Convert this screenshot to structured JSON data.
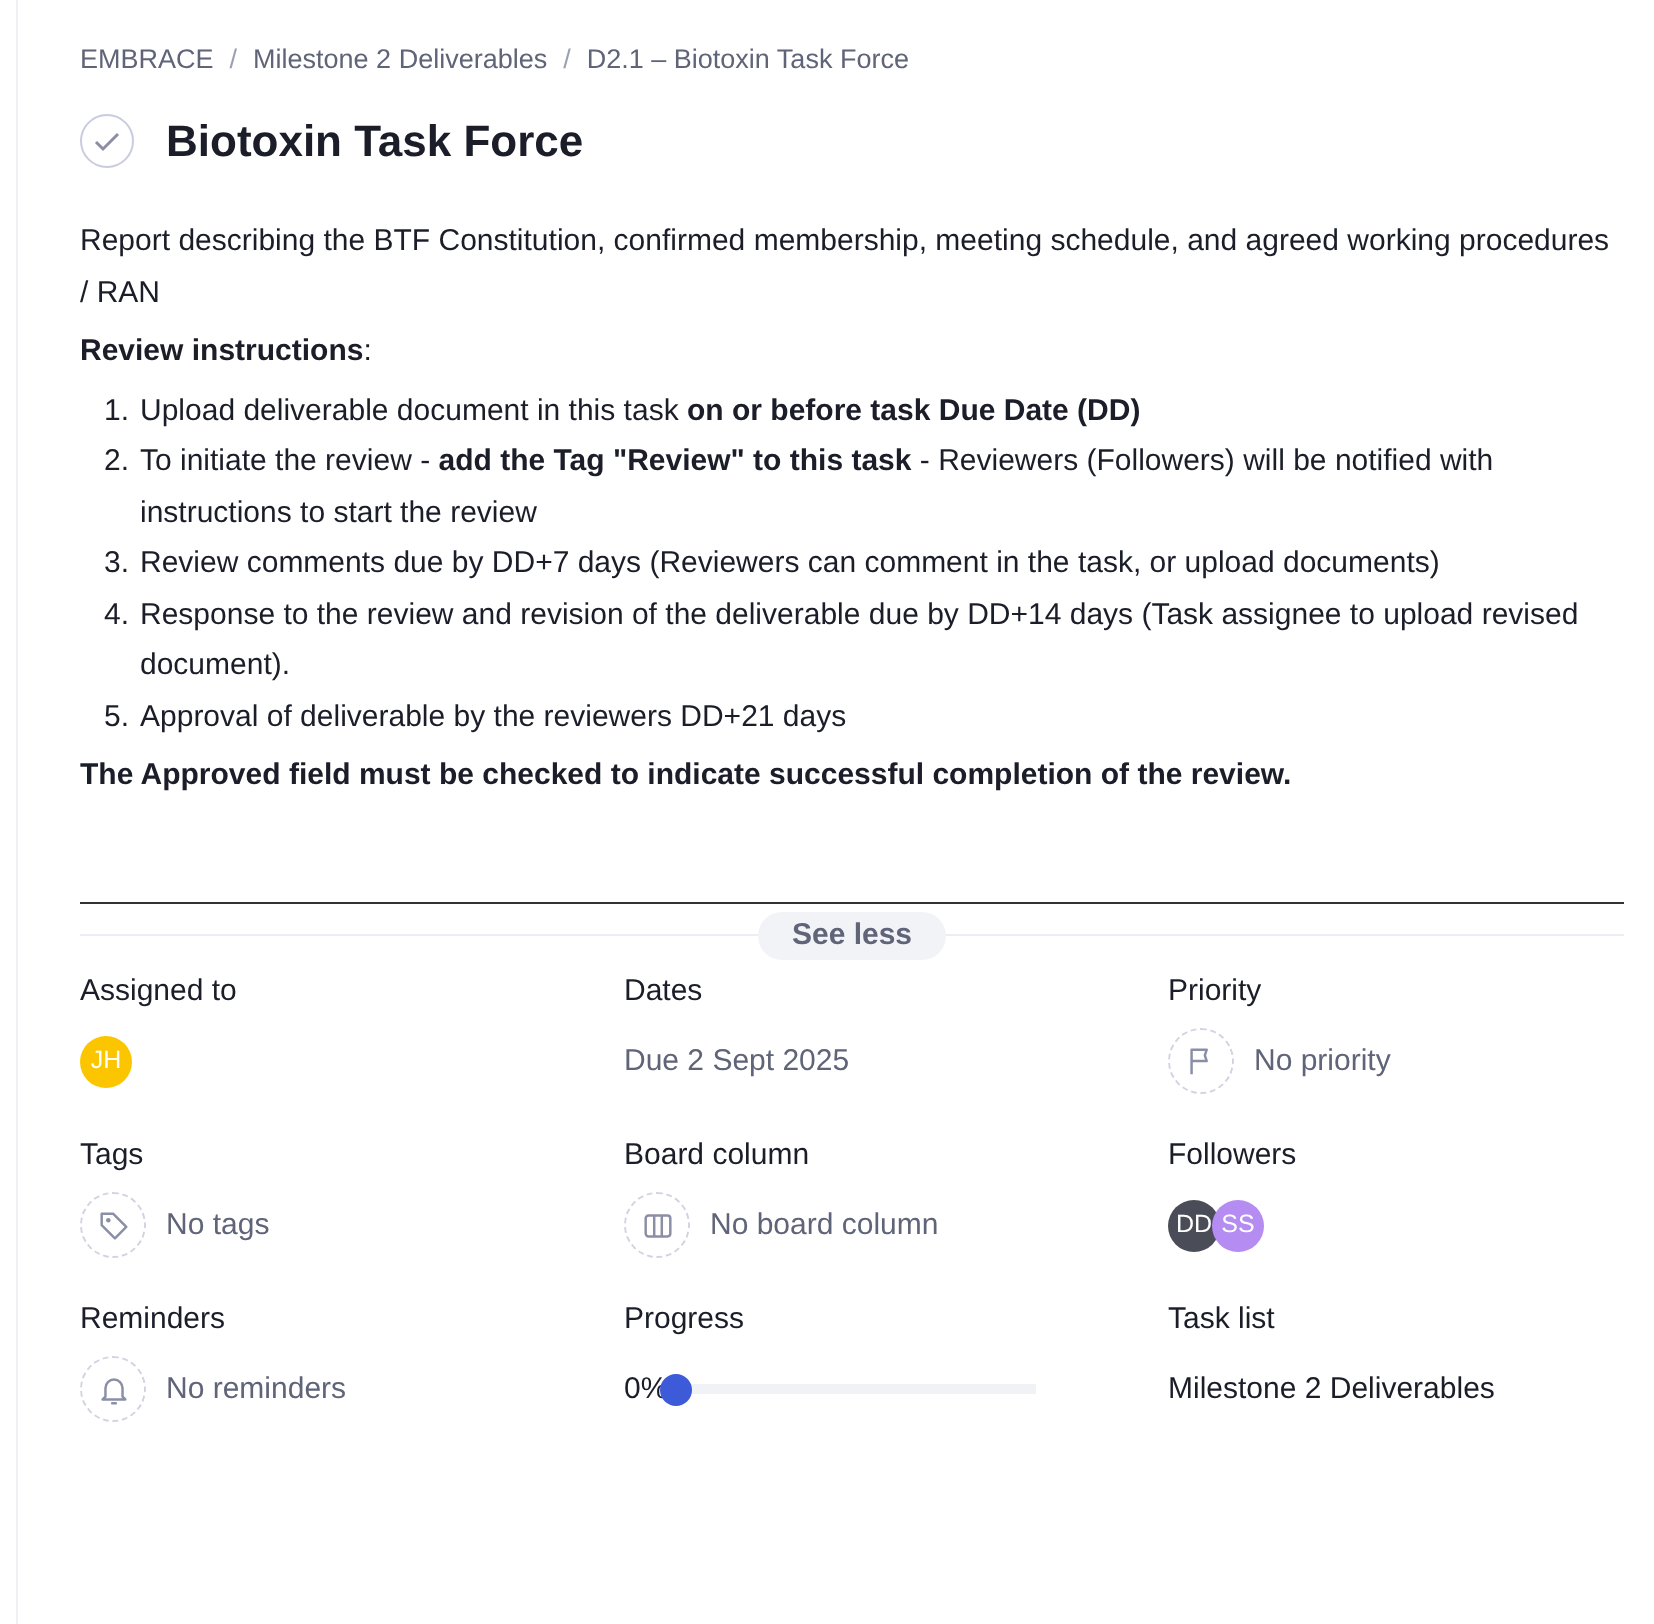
{
  "breadcrumb": {
    "separator": "/",
    "items": [
      "EMBRACE",
      "Milestone 2 Deliverables",
      "D2.1 – Biotoxin Task Force"
    ]
  },
  "task": {
    "title": "Biotoxin Task Force"
  },
  "description": {
    "intro": "Report describing the BTF Constitution, confirmed membership, meeting schedule, and agreed working procedures / RAN",
    "heading": "**Review instructions**:",
    "steps": [
      {
        "number": "1.",
        "text": "Upload deliverable document in this task **on or before task Due Date (DD)**"
      },
      {
        "number": "2.",
        "text": "To initiate the review - **add the Tag \"Review\" to this task** - Reviewers (Followers) will be notified with instructions to start the review"
      },
      {
        "number": "3.",
        "text": "Review comments due by DD+7 days (Reviewers can comment in the task, or upload documents)"
      },
      {
        "number": "4.",
        "text": "Response to the review and revision of the deliverable due by DD+14 days (Task assignee to upload revised document)."
      },
      {
        "number": "5.",
        "text": "Approval of deliverable by the reviewers DD+21 days"
      }
    ],
    "footer": "The Approved field must be checked to indicate successful completion of the review."
  },
  "toggle": {
    "label": "See less"
  },
  "fields": [
    {
      "label": "Assigned to",
      "kind": "people",
      "avatars": [
        {
          "initials": "JH",
          "color": "#fbc600"
        }
      ]
    },
    {
      "label": "Dates",
      "kind": "date",
      "value": "Due 2 Sept 2025"
    },
    {
      "label": "Priority",
      "kind": "priority",
      "value": "No priority"
    },
    {
      "label": "Tags",
      "kind": "tags",
      "value": "No tags"
    },
    {
      "label": "Board column",
      "kind": "board",
      "value": "No board column"
    },
    {
      "label": "Followers",
      "kind": "people",
      "avatars": [
        {
          "initials": "DD",
          "color": "#4a4d57"
        },
        {
          "initials": "SS",
          "color": "#b48cf2"
        }
      ]
    },
    {
      "label": "Reminders",
      "kind": "reminders",
      "value": "No reminders"
    },
    {
      "label": "Progress",
      "kind": "progress",
      "reading": "0%",
      "level": 0
    },
    {
      "label": "Task list",
      "kind": "list",
      "value": "Milestone 2 Deliverables"
    }
  ]
}
